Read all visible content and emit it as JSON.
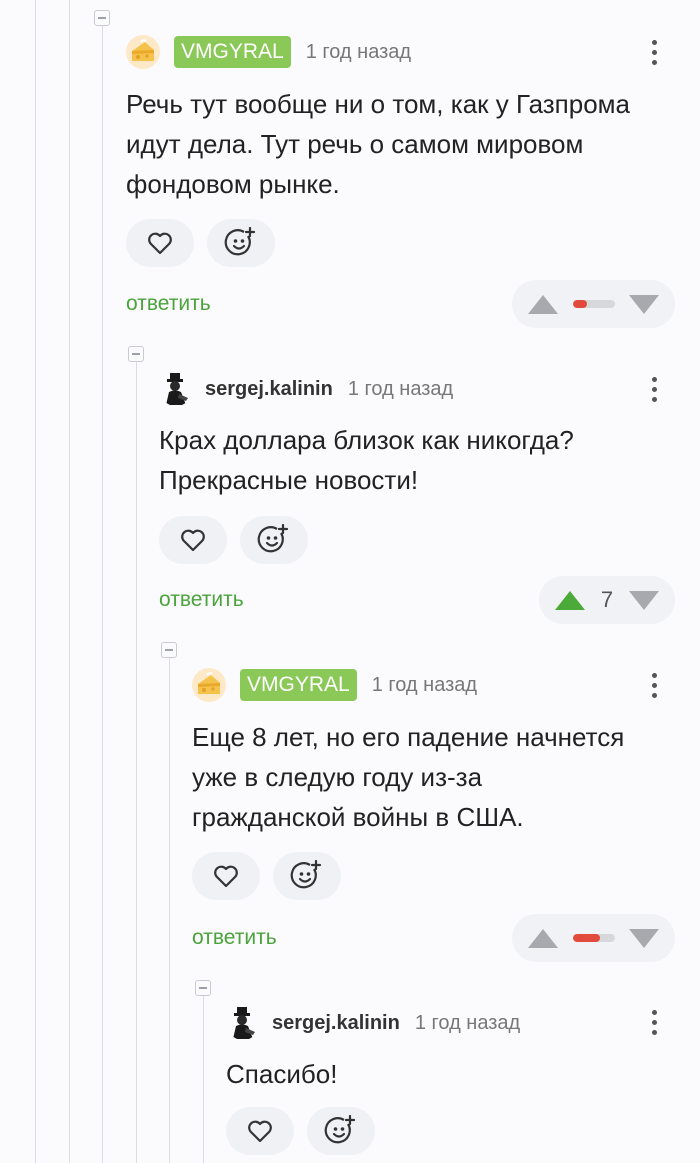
{
  "comments": [
    {
      "badge": "VMGYRAL",
      "time": "1 год назад",
      "text": "Речь тут вообще ни о том, как у Газпрома\nидут дела. Тут речь о самом мировом\nфондовом рынке.",
      "reply": "ответить",
      "vote": {
        "score": null,
        "ratio_negative": 0.35
      }
    },
    {
      "username": "sergej.kalinin",
      "time": "1 год назад",
      "text": "Крах доллара близок как никогда?\nПрекрасные новости!",
      "reply": "ответить",
      "vote": {
        "score": "7"
      }
    },
    {
      "badge": "VMGYRAL",
      "time": "1 год назад",
      "text": "Еще 8 лет, но его падение начнется\nуже в следую году из-за\nгражданской войны в США.",
      "reply": "ответить",
      "vote": {
        "score": null,
        "ratio_negative": 0.65
      }
    },
    {
      "username": "sergej.kalinin",
      "time": "1 год назад",
      "text": "Спасибо!"
    }
  ],
  "icons": {
    "like": "heart-icon",
    "add_reaction": "smiley-add-icon",
    "more": "more-vertical-icon",
    "collapse": "collapse-icon",
    "upvote": "arrow-up-icon",
    "downvote": "arrow-down-icon"
  },
  "colors": {
    "badge": "#8ac858",
    "reply": "#4aa43b",
    "upvote_active": "#4caa38",
    "negative": "#e24a3b"
  }
}
